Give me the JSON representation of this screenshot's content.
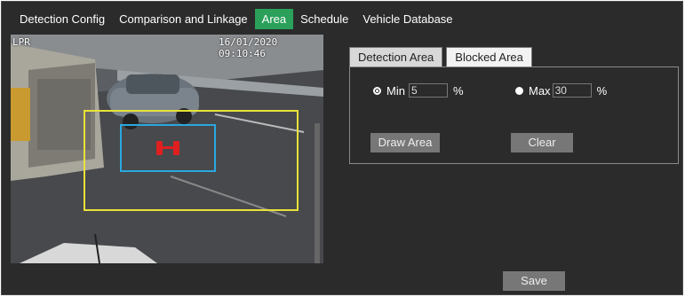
{
  "tabs": [
    {
      "label": "Detection Config",
      "active": false
    },
    {
      "label": "Comparison and Linkage",
      "active": false
    },
    {
      "label": "Area",
      "active": true
    },
    {
      "label": "Schedule",
      "active": false
    },
    {
      "label": "Vehicle Database",
      "active": false
    }
  ],
  "video": {
    "channel_label": "LPR",
    "timestamp": "16/01/2020 09:10:46"
  },
  "area_tabs": [
    {
      "label": "Detection Area",
      "active": true
    },
    {
      "label": "Blocked Area",
      "active": false
    }
  ],
  "min": {
    "label": "Min",
    "value": "5",
    "unit": "%"
  },
  "max": {
    "label": "Max",
    "value": "30",
    "unit": "%"
  },
  "buttons": {
    "draw_area": "Draw Area",
    "clear": "Clear",
    "save": "Save"
  },
  "colors": {
    "active_tab": "#2aa05a",
    "detection_box": "#e8e23a",
    "target_box": "#2aa8e0",
    "marker": "#e02020"
  }
}
